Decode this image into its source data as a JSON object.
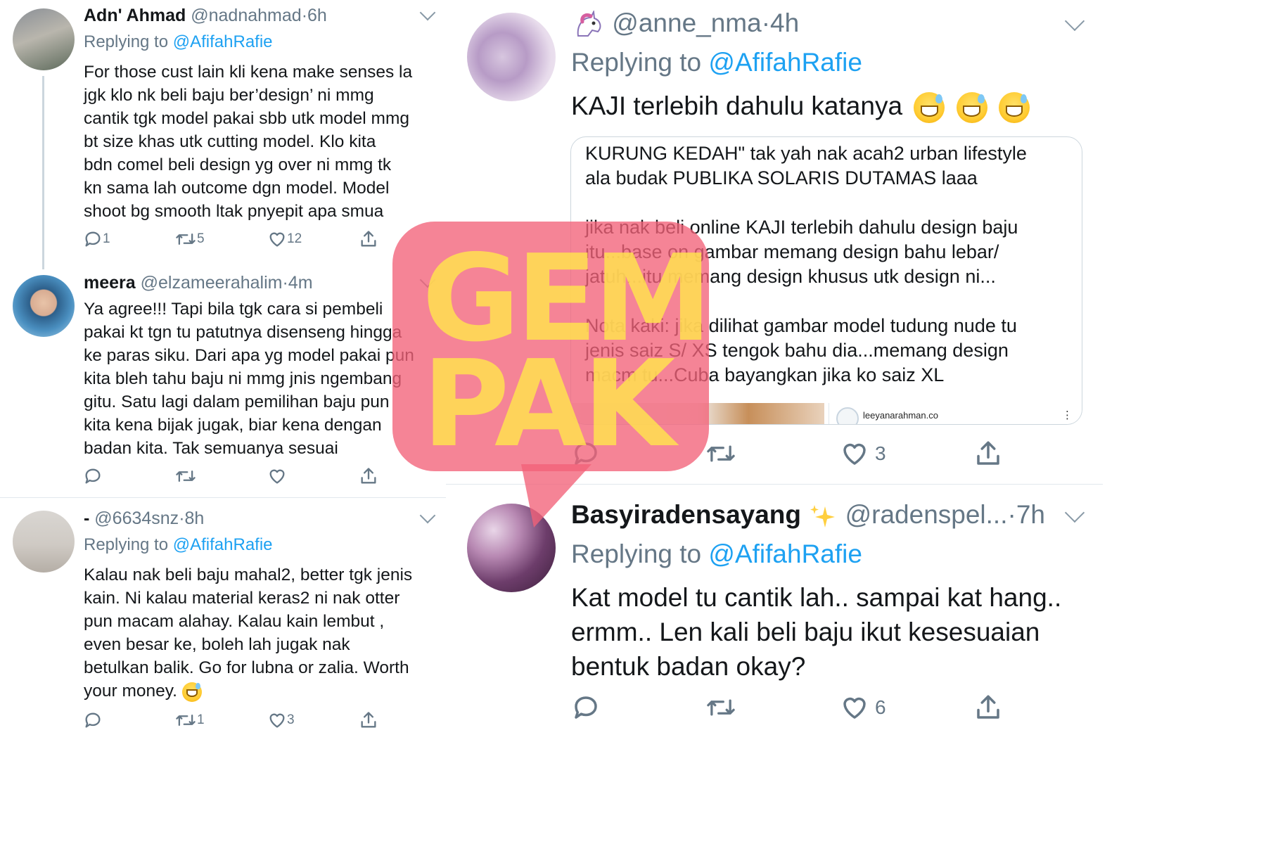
{
  "tweets_left": [
    {
      "name": "Adn' Ahmad",
      "handle": "@nadnahmad",
      "dot": "·",
      "time": "6h",
      "replying_prefix": "Replying to ",
      "replying_to": "@AfifahRafie",
      "lines": [
        "For those cust lain kli kena make senses la",
        "jgk klo nk beli baju ber’design’ ni mmg",
        "cantik tgk model pakai sbb utk model mmg",
        "bt size khas utk cutting model. Klo kita",
        "bdn comel beli design yg over ni mmg tk",
        "kn sama lah outcome dgn model. Model",
        "shoot bg smooth ltak pnyepit apa smua"
      ],
      "replies": "1",
      "retweets": "5",
      "likes": "12"
    },
    {
      "name": "meera",
      "handle": "@elzameerahalim",
      "dot": "·",
      "time": "4m",
      "lines": [
        "Ya agree!!! Tapi bila tgk cara si pembeli",
        "pakai kt tgn tu patutnya disenseng hingga",
        "ke paras siku. Dari apa yg model pakai pun",
        "kita bleh tahu baju ni mmg jnis ngembang",
        "gitu. Satu lagi dalam pemilihan baju pun",
        "kita kena bijak jugak, biar kena dengan",
        "badan kita. Tak semuanya sesuai"
      ],
      "replies": "",
      "retweets": "",
      "likes": ""
    },
    {
      "name": "-",
      "handle": "@6634snz",
      "dot": "·",
      "time": "8h",
      "replying_prefix": "Replying to ",
      "replying_to": "@AfifahRafie",
      "lines": [
        "Kalau nak beli baju mahal2, better tgk jenis",
        "kain. Ni kalau material keras2 ni nak otter",
        "pun macam alahay. Kalau kain lembut ,",
        "even besar ke, boleh lah jugak nak",
        "betulkan balik. Go for lubna or zalia. Worth",
        "your money."
      ],
      "replies": "",
      "retweets": "1",
      "likes": "3"
    }
  ],
  "tweets_right": [
    {
      "handle": "@anne_nma",
      "dot": "·",
      "time": "4h",
      "replying_prefix": "Replying to ",
      "replying_to": "@AfifahRafie",
      "text": "KAJI terlebih dahulu katanya",
      "quote_lines_a": [
        "KURUNG KEDAH\" tak yah nak acah2 urban lifestyle",
        "ala budak PUBLIKA SOLARIS DUTAMAS laaa"
      ],
      "quote_lines_b": [
        "jika nak beli online KAJI terlebih dahulu design baju",
        "itu...base on gambar memang design bahu lebar/",
        "jatuh...itu memang design khusus utk design ni..."
      ],
      "quote_lines_c": [
        "Nota kaki: jika dilihat gambar model tudung nude tu",
        "jenis saiz S/ XS tengok bahu dia...memang design",
        "macm tu...Cuba bayangkan jika ko saiz XL"
      ],
      "quote_account": "leeyanarahman.co",
      "quote_more": "⋮",
      "replies": "",
      "retweets": "",
      "likes": "3"
    },
    {
      "name": "Basyiradensayang",
      "handle": "@radenspel...",
      "dot": "·",
      "time": "7h",
      "replying_prefix": "Replying to ",
      "replying_to": "@AfifahRafie",
      "lines": [
        "Kat model tu cantik lah.. sampai kat hang..",
        "ermm.. Len kali beli baju ikut kesesuaian",
        "bentuk badan okay?"
      ],
      "replies": "",
      "retweets": "",
      "likes": "6"
    }
  ],
  "watermark": {
    "line1": "GEM",
    "line2": "PAK"
  },
  "icons": {
    "reply": "reply-icon",
    "retweet": "retweet-icon",
    "like": "heart-icon",
    "share": "share-icon",
    "unicorn": "unicorn-emoji",
    "sparkles": "sparkles-emoji",
    "sweat": "sweat-smile-emoji"
  },
  "colors": {
    "link": "#1da1f2",
    "muted": "#657786",
    "text": "#14171a",
    "watermark_bg": "#f26278",
    "watermark_text": "#ffe150"
  }
}
